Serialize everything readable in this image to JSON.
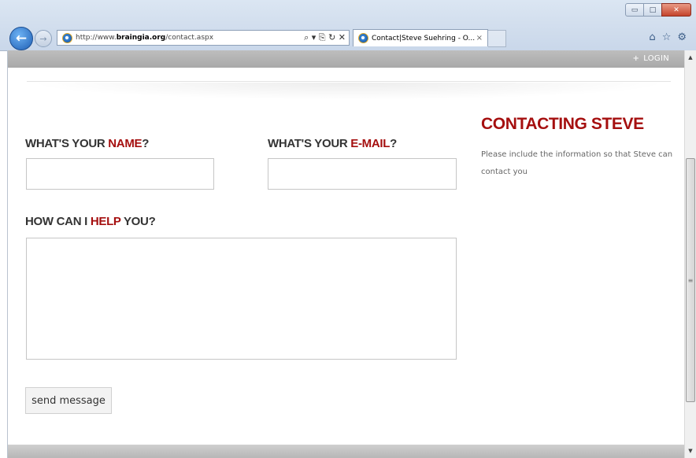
{
  "browser": {
    "url_prefix": "http://www.",
    "url_domain": "braingia.org",
    "url_path": "/contact.aspx",
    "address_actions": "⌕ ▾ ⎘ ↻ ✕",
    "tab_title": "Contact|Steve Suehring - O...",
    "tab_close": "×",
    "window_controls": {
      "minimize": "▭",
      "maximize": "□",
      "close": "✕"
    },
    "toolbar_icons": {
      "home": "⌂",
      "favorites": "☆",
      "tools": "⚙"
    },
    "back_icon": "←",
    "forward_icon": "→"
  },
  "page": {
    "login_plus": "+",
    "login_label": "LOGIN",
    "form": {
      "name_label_prefix": "WHAT'S YOUR ",
      "name_label_highlight": "NAME",
      "name_label_suffix": "?",
      "name_value": "",
      "email_label_prefix": "WHAT'S YOUR ",
      "email_label_highlight": "E-MAIL",
      "email_label_suffix": "?",
      "email_value": "",
      "message_label_prefix": "HOW CAN I ",
      "message_label_highlight": "HELP",
      "message_label_suffix": " YOU?",
      "message_value": "",
      "send_button": "send message"
    },
    "sidebar": {
      "title": "CONTACTING STEVE",
      "text": "Please include the information so that Steve can contact you"
    }
  },
  "scrollbar": {
    "up": "▲",
    "down": "▼",
    "grip": "≡"
  },
  "colors": {
    "accent": "#a50f0f",
    "heading": "#333333",
    "topbar": "#b3b3b3"
  }
}
